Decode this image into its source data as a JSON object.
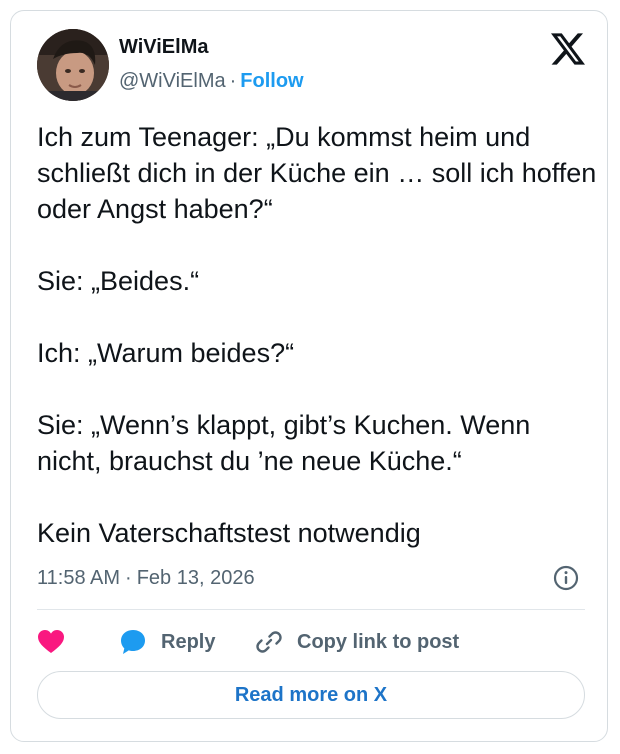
{
  "author": {
    "name": "WiViElMa",
    "handle": "@WiViElMa",
    "separator": "·",
    "follow_label": "Follow"
  },
  "icons": {
    "logo": "x-logo-icon",
    "info": "info-icon",
    "like": "heart-icon",
    "reply": "speech-bubble-icon",
    "copy": "link-icon"
  },
  "tweet": {
    "text": "Ich zum Teenager: „Du kommst heim und schließt dich in der Küche ein … soll ich hoffen oder Angst haben?“\n\nSie: „Beides.“\n\nIch: „Warum beides?“\n\nSie: „Wenn’s klappt, gibt’s Kuchen. Wenn nicht, brauchst du ’ne neue Küche.“\n\nKein Vaterschaftstest notwendig",
    "time": "11:58 AM",
    "separator": "·",
    "date": "Feb 13, 2026"
  },
  "actions": {
    "reply_label": "Reply",
    "copy_label": "Copy link to post",
    "read_more_label": "Read more on X"
  },
  "colors": {
    "link": "#1d9bf0",
    "like": "#f91880",
    "reply_icon": "#1d9bf0",
    "text": "#0f1419",
    "muted": "#536471"
  }
}
